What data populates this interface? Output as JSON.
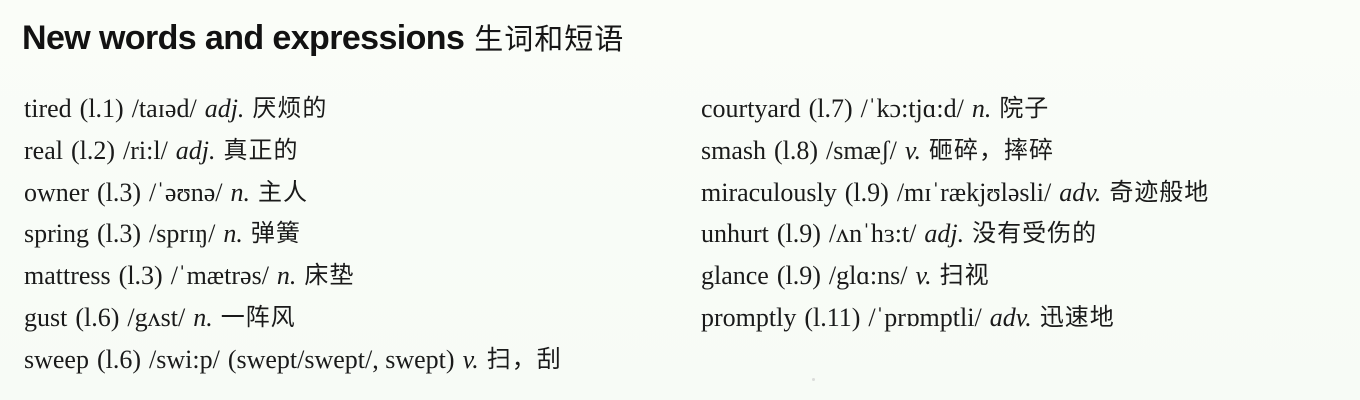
{
  "page": {
    "heading": {
      "english": "New words and expressions",
      "chinese": "生词和短语"
    },
    "left_column": [
      {
        "term": "tired",
        "ref": "(l.1)",
        "phonetic": "/taɪəd/",
        "pos": "adj.",
        "meaning": "厌烦的"
      },
      {
        "term": "real",
        "ref": "(l.2)",
        "phonetic": "/ri:l/",
        "pos": "adj.",
        "meaning": "真正的"
      },
      {
        "term": "owner",
        "ref": "(l.3)",
        "phonetic": "/ˈəʊnə/",
        "pos": "n.",
        "meaning": "主人"
      },
      {
        "term": "spring",
        "ref": "(l.3)",
        "phonetic": "/sprɪŋ/",
        "pos": "n.",
        "meaning": "弹簧"
      },
      {
        "term": "mattress",
        "ref": "(l.3)",
        "phonetic": "/ˈmætrəs/",
        "pos": "n.",
        "meaning": "床垫"
      },
      {
        "term": "gust",
        "ref": "(l.6)",
        "phonetic": "/gʌst/",
        "pos": "n.",
        "meaning": "一阵风"
      },
      {
        "term": "sweep",
        "ref": "(l.6)",
        "phonetic": "/swi:p/",
        "forms": "(swept/swept/, swept)",
        "pos": "v.",
        "meaning": "扫，刮"
      }
    ],
    "right_column": [
      {
        "term": "courtyard",
        "ref": "(l.7)",
        "phonetic": "/ˈkɔ:tjɑ:d/",
        "pos": "n.",
        "meaning": "院子"
      },
      {
        "term": "smash",
        "ref": "(l.8)",
        "phonetic": "/smæʃ/",
        "pos": "v.",
        "meaning": "砸碎，摔碎"
      },
      {
        "term": "miraculously",
        "ref": "(l.9)",
        "phonetic": "/mɪˈrækjʊləsli/",
        "pos": "adv.",
        "meaning": "奇迹般地"
      },
      {
        "term": "unhurt",
        "ref": "(l.9)",
        "phonetic": "/ʌnˈhɜ:t/",
        "pos": "adj.",
        "meaning": "没有受伤的"
      },
      {
        "term": "glance",
        "ref": "(l.9)",
        "phonetic": "/glɑ:ns/",
        "pos": "v.",
        "meaning": "扫视"
      },
      {
        "term": "promptly",
        "ref": "(l.11)",
        "phonetic": "/ˈprɒmptli/",
        "pos": "adv.",
        "meaning": "迅速地"
      }
    ]
  }
}
